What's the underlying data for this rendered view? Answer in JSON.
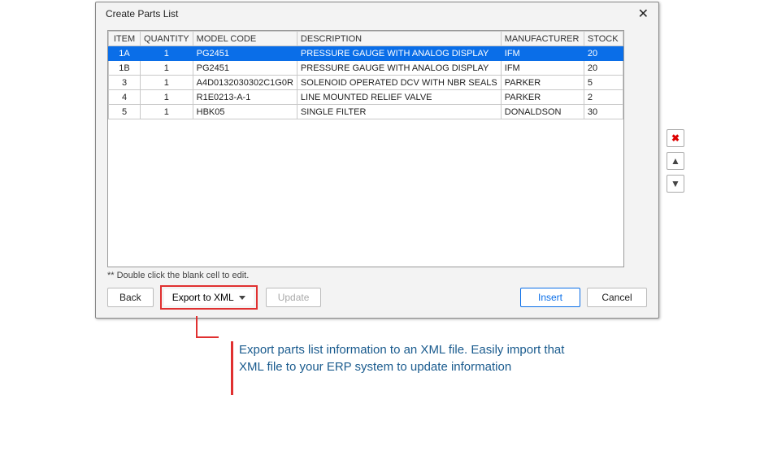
{
  "dialog": {
    "title": "Create Parts List",
    "hint": "** Double click the blank cell to edit."
  },
  "table": {
    "headers": [
      "ITEM",
      "QUANTITY",
      "MODEL CODE",
      "DESCRIPTION",
      "MANUFACTURER",
      "STOCK"
    ],
    "rows": [
      {
        "item": "1A",
        "quantity": "1",
        "model": "PG2451",
        "desc": "PRESSURE GAUGE WITH ANALOG DISPLAY",
        "mfr": "IFM",
        "stock": "20",
        "selected": true
      },
      {
        "item": "1B",
        "quantity": "1",
        "model": "PG2451",
        "desc": "PRESSURE GAUGE WITH ANALOG DISPLAY",
        "mfr": "IFM",
        "stock": "20",
        "selected": false
      },
      {
        "item": "3",
        "quantity": "1",
        "model": "A4D0132030302C1G0R",
        "desc": "SOLENOID OPERATED DCV WITH NBR SEALS",
        "mfr": "PARKER",
        "stock": "5",
        "selected": false
      },
      {
        "item": "4",
        "quantity": "1",
        "model": "R1E0213-A-1",
        "desc": "LINE MOUNTED RELIEF VALVE",
        "mfr": "PARKER",
        "stock": "2",
        "selected": false
      },
      {
        "item": "5",
        "quantity": "1",
        "model": "HBK05",
        "desc": "SINGLE FILTER",
        "mfr": "DONALDSON",
        "stock": "30",
        "selected": false
      }
    ]
  },
  "sidebuttons": {
    "delete": "✖",
    "up": "▲",
    "down": "▼"
  },
  "footer": {
    "back": "Back",
    "export": "Export to XML",
    "update": "Update",
    "insert": "Insert",
    "cancel": "Cancel"
  },
  "annotation": "Export parts list information to an XML file. Easily import that XML file to your ERP system to update information"
}
